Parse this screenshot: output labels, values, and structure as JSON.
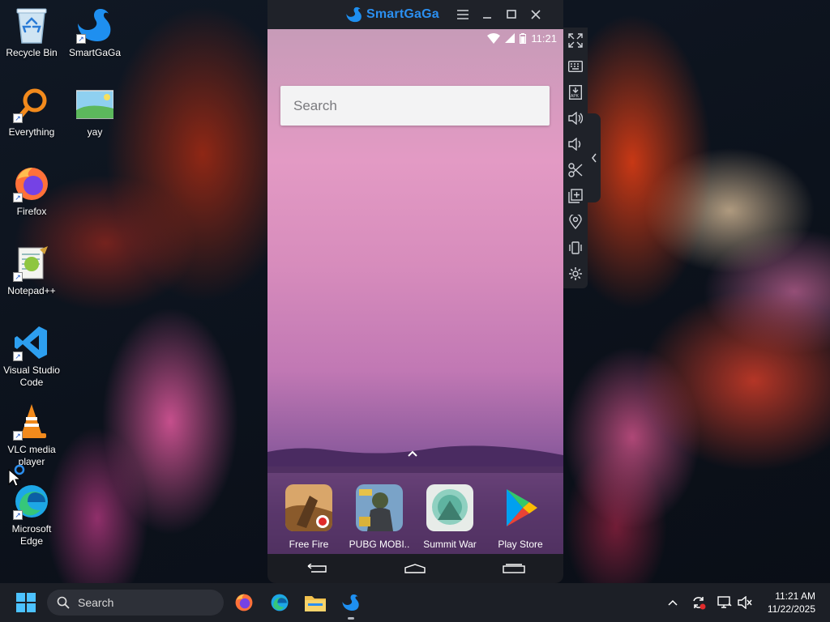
{
  "desktop": {
    "icons": [
      {
        "label": "Recycle Bin"
      },
      {
        "label": "SmartGaGa"
      },
      {
        "label": "Everything"
      },
      {
        "label": "yay"
      },
      {
        "label": "Firefox"
      },
      {
        "label": "Notepad++"
      },
      {
        "label": "Visual Studio Code"
      },
      {
        "label": "VLC media player"
      },
      {
        "label": "Microsoft Edge"
      }
    ]
  },
  "emulator": {
    "brand": "SmartGaGa",
    "status_time": "11:21",
    "search_placeholder": "Search",
    "dock_apps": [
      {
        "name": "Free Fire"
      },
      {
        "name": "PUBG MOBI.."
      },
      {
        "name": "Summit War"
      },
      {
        "name": "Play Store"
      }
    ],
    "sidebar_icons": [
      "fullscreen-icon",
      "keyboard-icon",
      "apk-install-icon",
      "volume-up-icon",
      "volume-down-icon",
      "screenshot-icon",
      "multi-instance-icon",
      "location-icon",
      "shake-icon",
      "settings-icon"
    ]
  },
  "taskbar": {
    "search_label": "Search",
    "time": "11:21 AM",
    "date": "11/22/2025"
  },
  "colors": {
    "brand_blue": "#2b8ff0",
    "taskbar_bg": "#1c1f26",
    "emulator_chrome": "#1f2229"
  }
}
